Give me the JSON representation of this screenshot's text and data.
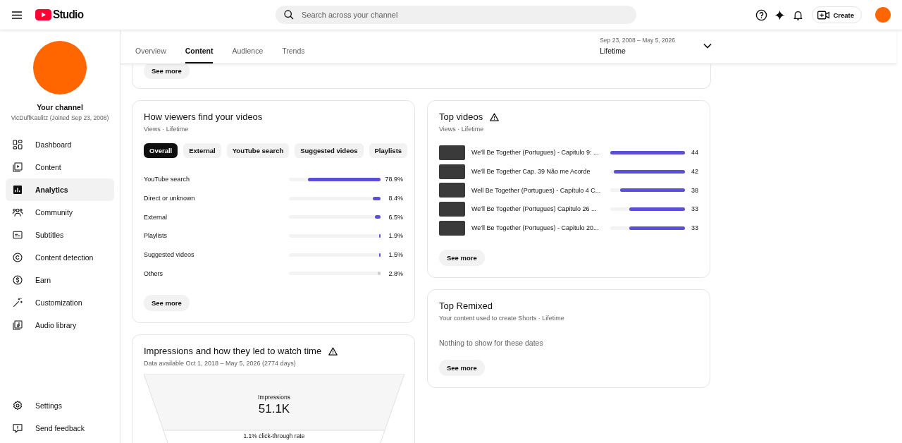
{
  "header": {
    "logo_text": "Studio",
    "search": {
      "placeholder": "Search across your channel"
    },
    "create_button": "Create"
  },
  "sidebar": {
    "channel": {
      "title": "Your channel",
      "subtitle": "VicDuffKaulitz (Joined Sep 23, 2008)"
    },
    "items": [
      {
        "label": "Dashboard",
        "kind": "dashboard",
        "selected": false
      },
      {
        "label": "Content",
        "kind": "content",
        "selected": false
      },
      {
        "label": "Analytics",
        "kind": "analytics",
        "selected": true
      },
      {
        "label": "Community",
        "kind": "community",
        "selected": false
      },
      {
        "label": "Subtitles",
        "kind": "subtitles",
        "selected": false
      },
      {
        "label": "Content detection",
        "kind": "copyright",
        "selected": false
      },
      {
        "label": "Earn",
        "kind": "earn",
        "selected": false
      },
      {
        "label": "Customization",
        "kind": "customization",
        "selected": false
      },
      {
        "label": "Audio library",
        "kind": "audio",
        "selected": false
      }
    ],
    "footer_items": [
      {
        "label": "Settings",
        "kind": "settings"
      },
      {
        "label": "Send feedback",
        "kind": "feedback"
      }
    ]
  },
  "tabs": [
    {
      "label": "Overview",
      "selected": false
    },
    {
      "label": "Content",
      "selected": true
    },
    {
      "label": "Audience",
      "selected": false
    },
    {
      "label": "Trends",
      "selected": false
    }
  ],
  "date_range": {
    "range": "Sep 23, 2008 – May 5, 2026",
    "label": "Lifetime"
  },
  "previous_card": {
    "button": "See more"
  },
  "traffic_card": {
    "title": "How viewers find your videos",
    "subtitle": "Views · Lifetime",
    "chips": [
      {
        "label": "Overall",
        "selected": true
      },
      {
        "label": "External",
        "selected": false
      },
      {
        "label": "YouTube search",
        "selected": false
      },
      {
        "label": "Suggested videos",
        "selected": false
      },
      {
        "label": "Playlists",
        "selected": false
      }
    ],
    "rows": [
      {
        "label": "YouTube search",
        "level": 0.789,
        "value": "78.9%",
        "color": "#5a4fd6"
      },
      {
        "label": "Direct or unknown",
        "level": 0.084,
        "value": "8.4%",
        "color": "#5a4fd6"
      },
      {
        "label": "External",
        "level": 0.065,
        "value": "6.5%",
        "color": "#5a4fd6"
      },
      {
        "label": "Playlists",
        "level": 0.019,
        "value": "1.9%",
        "color": "#5a4fd6"
      },
      {
        "label": "Suggested videos",
        "level": 0.015,
        "value": "1.5%",
        "color": "#5a4fd6"
      },
      {
        "label": "Others",
        "level": 0.028,
        "value": "2.8%",
        "color": "#cccccc"
      }
    ],
    "button": "See more"
  },
  "impressions_card": {
    "title": "Impressions and how they led to watch time",
    "subtitle": "Data available Oct 1, 2018 – May 5, 2026 (2774 days)",
    "funnel": {
      "label": "Impressions",
      "value": "51.1K",
      "next": "1.1% click-through rate"
    }
  },
  "top_videos_card": {
    "title": "Top videos",
    "subtitle": "Views · Lifetime",
    "videos": [
      {
        "title": "We'll Be Together (Portugues) - Capitulo 9: ...",
        "level": 1,
        "views": "44"
      },
      {
        "title": "We'll Be Together Cap. 39 Não me Acorde",
        "level": 0.955,
        "views": "42"
      },
      {
        "title": "Well Be Together (Portugues) - Capítulo 4 C...",
        "level": 0.864,
        "views": "38"
      },
      {
        "title": "We'll Be Together (Portugues) Capitulo 26 ...",
        "level": 0.75,
        "views": "33"
      },
      {
        "title": "We'll Be Together (Portugues) - Capitulo 20...",
        "level": 0.75,
        "views": "33"
      }
    ],
    "button": "See more"
  },
  "top_remixed_card": {
    "title": "Top Remixed",
    "subtitle": "Your content used to create Shorts · Lifetime",
    "empty_text": "Nothing to show for these dates",
    "button": "See more"
  }
}
